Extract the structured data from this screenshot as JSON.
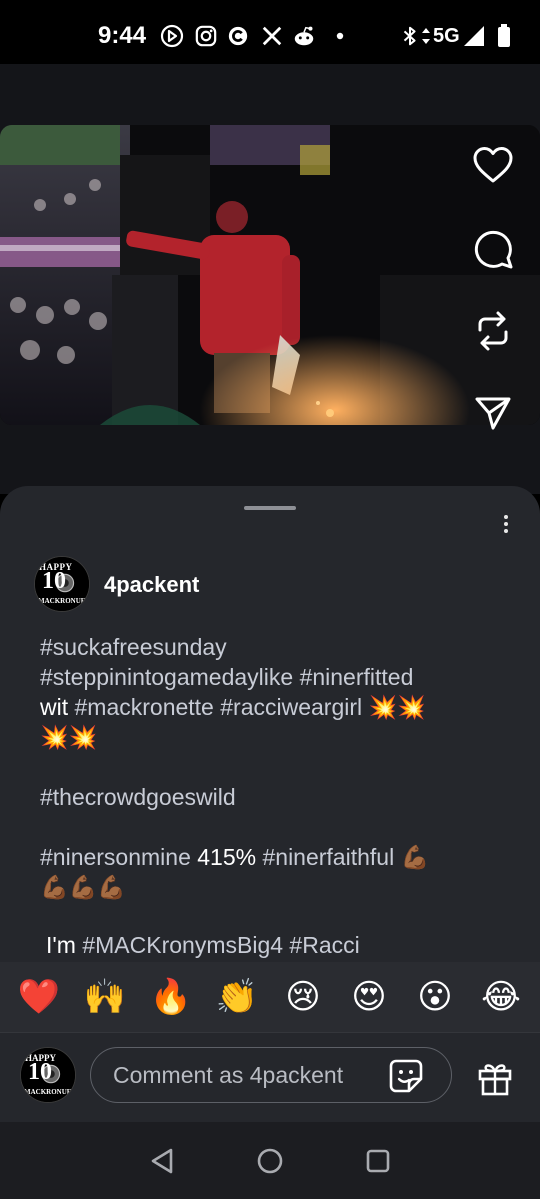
{
  "status_bar": {
    "time": "9:44",
    "left_icons": [
      "play-circle-icon",
      "instagram-icon",
      "c-app-icon",
      "x-icon",
      "reddit-icon",
      "dot-icon"
    ],
    "network": "5G",
    "right_icons": [
      "bluetooth-icon",
      "data-arrows-icon",
      "signal-icon",
      "battery-icon"
    ]
  },
  "reel": {
    "actions": [
      "heart-icon",
      "comment-icon",
      "repost-icon",
      "share-icon"
    ]
  },
  "post": {
    "username": "4packent",
    "avatar_logo": {
      "top": "HAPPY",
      "number": "10",
      "bottom": "MACKRONUFB"
    },
    "caption_lines": [
      [
        {
          "type": "tag",
          "text": "#suckafreesunday"
        }
      ],
      [
        {
          "type": "tag",
          "text": "#steppinintogamedaylike"
        },
        {
          "type": "text",
          "text": " "
        },
        {
          "type": "tag",
          "text": "#ninerfitted"
        }
      ],
      [
        {
          "type": "text",
          "text": "wit "
        },
        {
          "type": "tag",
          "text": "#mackronette"
        },
        {
          "type": "text",
          "text": " "
        },
        {
          "type": "tag",
          "text": "#racciweargirl"
        },
        {
          "type": "text",
          "text": " 💥💥"
        }
      ],
      [
        {
          "type": "text",
          "text": "💥💥"
        }
      ]
    ],
    "caption_block_2": "#thecrowdgoeswild",
    "caption_block_3": [
      {
        "type": "tag",
        "text": "#ninersonmine"
      },
      {
        "type": "text",
        "text": " 415% "
      },
      {
        "type": "tag",
        "text": "#ninerfaithful"
      },
      {
        "type": "text",
        "text": " 💪🏾"
      }
    ],
    "caption_block_3b": "💪🏾💪🏾💪🏾",
    "caption_last_prefix": "I'm ",
    "caption_last_tags": "#MACKronymsBig4 #Racci"
  },
  "emoji_bar": [
    "❤️",
    "🙌",
    "🔥",
    "👏",
    "😢",
    "😍",
    "😮",
    "😂"
  ],
  "comment_box": {
    "placeholder": "Comment as 4packent"
  },
  "nav_bar": {
    "buttons": [
      "back-icon",
      "home-icon",
      "recents-icon"
    ]
  },
  "colors": {
    "sheet_bg": "#25272c",
    "hashtag": "#c8ccd6",
    "background": "#000000"
  }
}
